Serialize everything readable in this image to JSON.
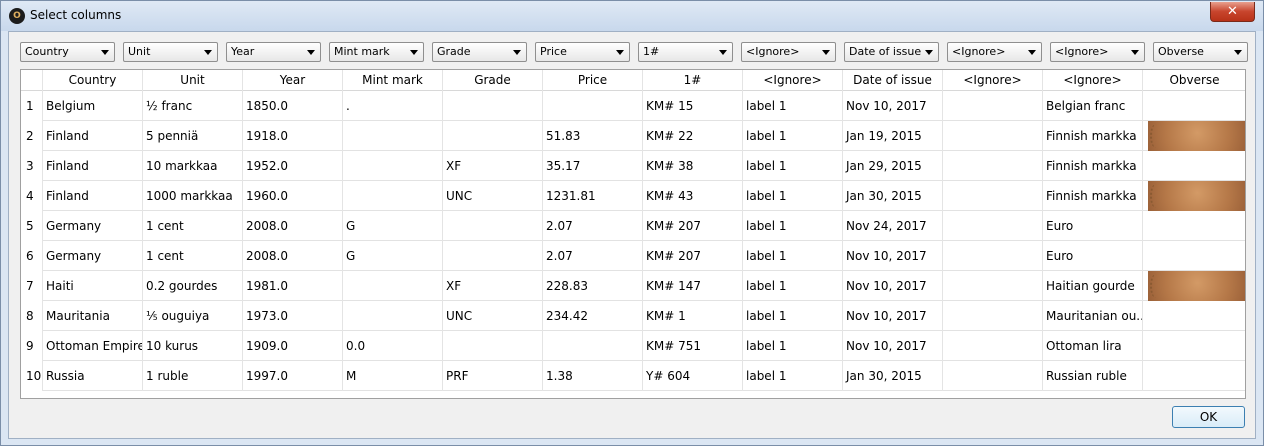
{
  "window": {
    "title": "Select columns",
    "close_label": "✕"
  },
  "selects": [
    "Country",
    "Unit",
    "Year",
    "Mint mark",
    "Grade",
    "Price",
    "1#",
    "<Ignore>",
    "Date of issue",
    "<Ignore>",
    "<Ignore>",
    "Obverse"
  ],
  "table": {
    "headers": [
      "Country",
      "Unit",
      "Year",
      "Mint mark",
      "Grade",
      "Price",
      "1#",
      "<Ignore>",
      "Date of issue",
      "<Ignore>",
      "<Ignore>",
      "Obverse"
    ],
    "rows": [
      {
        "num": "1",
        "cells": [
          "Belgium",
          "½ franc",
          "1850.0",
          ".",
          "",
          "",
          "KM# 15",
          "label 1",
          "Nov 10, 2017",
          "",
          "Belgian franc"
        ],
        "obverse": false
      },
      {
        "num": "2",
        "cells": [
          "Finland",
          "5 penniä",
          "1918.0",
          "",
          "",
          "51.83",
          "KM# 22",
          "label 1",
          "Jan 19, 2015",
          "",
          "Finnish markka"
        ],
        "obverse": true
      },
      {
        "num": "3",
        "cells": [
          "Finland",
          "10 markkaa",
          "1952.0",
          "",
          "XF",
          "35.17",
          "KM# 38",
          "label 1",
          "Jan 29, 2015",
          "",
          "Finnish markka"
        ],
        "obverse": false
      },
      {
        "num": "4",
        "cells": [
          "Finland",
          "1000 markkaa",
          "1960.0",
          "",
          "UNC",
          "1231.81",
          "KM# 43",
          "label 1",
          "Jan 30, 2015",
          "",
          "Finnish markka"
        ],
        "obverse": true
      },
      {
        "num": "5",
        "cells": [
          "Germany",
          "1 cent",
          "2008.0",
          "G",
          "",
          "2.07",
          "KM# 207",
          "label 1",
          "Nov 24, 2017",
          "",
          "Euro"
        ],
        "obverse": false
      },
      {
        "num": "6",
        "cells": [
          "Germany",
          "1 cent",
          "2008.0",
          "G",
          "",
          "2.07",
          "KM# 207",
          "label 1",
          "Nov 10, 2017",
          "",
          "Euro"
        ],
        "obverse": false
      },
      {
        "num": "7",
        "cells": [
          "Haiti",
          "0.2 gourdes",
          "1981.0",
          "",
          "XF",
          "228.83",
          "KM# 147",
          "label 1",
          "Nov 10, 2017",
          "",
          "Haitian gourde"
        ],
        "obverse": true
      },
      {
        "num": "8",
        "cells": [
          "Mauritania",
          "⅕ ouguiya",
          "1973.0",
          "",
          "UNC",
          "234.42",
          "KM# 1",
          "label 1",
          "Nov 10, 2017",
          "",
          "Mauritanian ou..."
        ],
        "obverse": false
      },
      {
        "num": "9",
        "cells": [
          "Ottoman Empire",
          "10 kurus",
          "1909.0",
          "0.0",
          "",
          "",
          "KM# 751",
          "label 1",
          "Nov 10, 2017",
          "",
          "Ottoman lira"
        ],
        "obverse": false
      },
      {
        "num": "10",
        "cells": [
          "Russia",
          "1 ruble",
          "1997.0",
          "M",
          "PRF",
          "1.38",
          "Y# 604",
          "label 1",
          "Jan 30, 2015",
          "",
          "Russian ruble"
        ],
        "obverse": false
      }
    ]
  },
  "buttons": {
    "ok_label": "OK"
  },
  "colors": {
    "coin": "#b57848",
    "ok_border": "#3c7fb1",
    "close": "#c8452d"
  }
}
